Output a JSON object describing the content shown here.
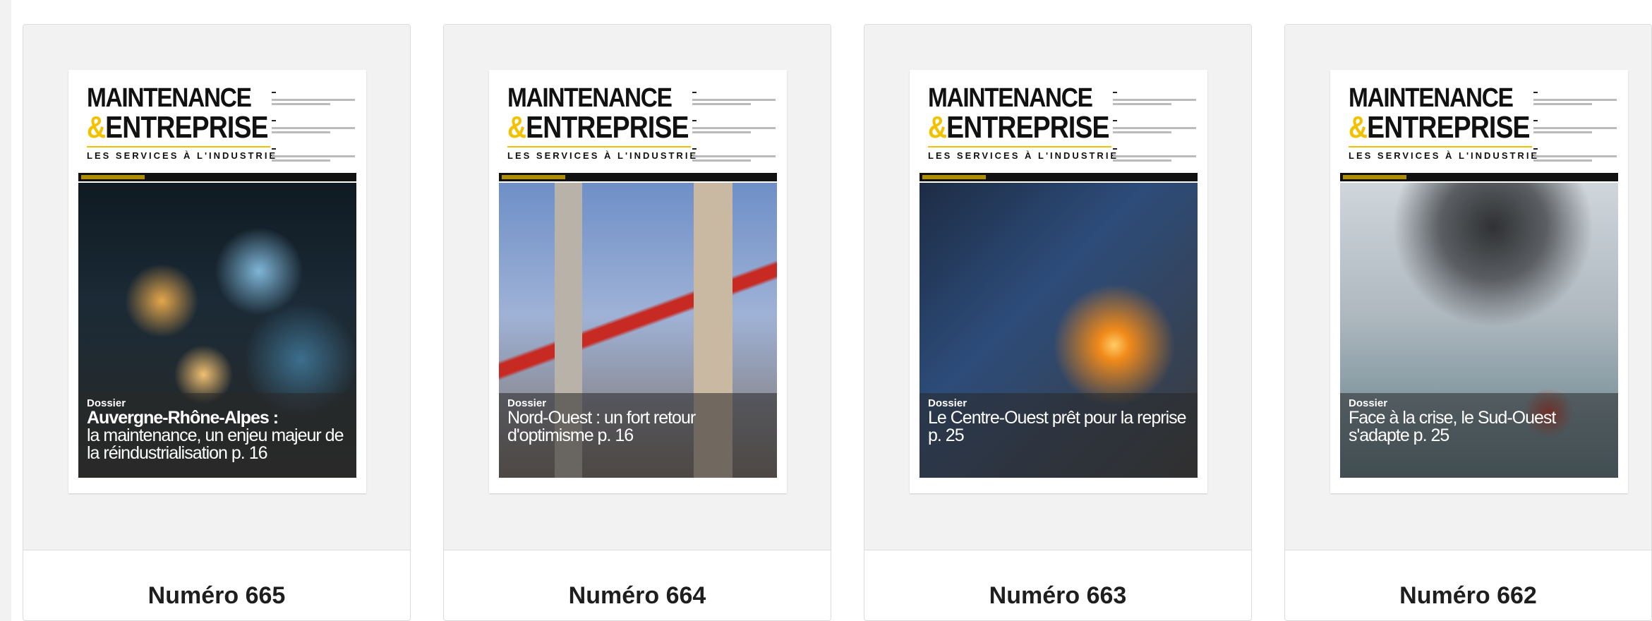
{
  "issues": [
    {
      "title": "Numéro 665",
      "cover": {
        "masthead_line1": "MAINTENANCE",
        "masthead_amp": "&",
        "masthead_line2": "ENTREPRISE",
        "tagline": "LES SERVICES À L'INDUSTRIE",
        "dossier_label": "Dossier",
        "headline_bold": "Auvergne-Rhône-Alpes :",
        "headline_rest": "la maintenance, un enjeu majeur de la réindustrialisation  p. 16"
      }
    },
    {
      "title": "Numéro 664",
      "cover": {
        "masthead_line1": "MAINTENANCE",
        "masthead_amp": "&",
        "masthead_line2": "ENTREPRISE",
        "tagline": "LES SERVICES À L'INDUSTRIE",
        "dossier_label": "Dossier",
        "headline_bold": "",
        "headline_rest": "Nord-Ouest : un fort retour d'optimisme p. 16"
      }
    },
    {
      "title": "Numéro 663",
      "cover": {
        "masthead_line1": "MAINTENANCE",
        "masthead_amp": "&",
        "masthead_line2": "ENTREPRISE",
        "tagline": "LES SERVICES À L'INDUSTRIE",
        "dossier_label": "Dossier",
        "headline_bold": "",
        "headline_rest": "Le Centre-Ouest prêt pour la reprise p. 25"
      }
    },
    {
      "title": "Numéro 662",
      "cover": {
        "masthead_line1": "MAINTENANCE",
        "masthead_amp": "&",
        "masthead_line2": "ENTREPRISE",
        "tagline": "LES SERVICES À L'INDUSTRIE",
        "dossier_label": "Dossier",
        "headline_bold": "",
        "headline_rest": "Face à la crise, le Sud-Ouest s'adapte  p. 25"
      }
    }
  ]
}
